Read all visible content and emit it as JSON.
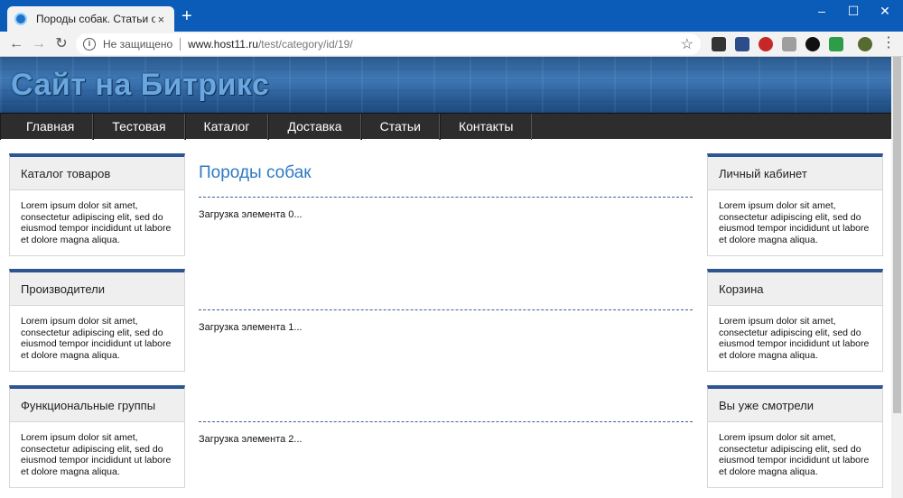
{
  "browser": {
    "tab_title": "Породы собак. Статьи о домаш",
    "tab_close": "×",
    "new_tab": "+",
    "insecure_label": "Не защищено",
    "url_host": "www.host11.ru",
    "url_path": "/test/category/id/19/",
    "window_controls": [
      "–",
      "☐",
      "✕"
    ]
  },
  "site": {
    "title": "Сайт на Битрикс",
    "nav": [
      "Главная",
      "Тестовая",
      "Каталог",
      "Доставка",
      "Статьи",
      "Контакты"
    ]
  },
  "left_boxes": [
    {
      "title": "Каталог товаров",
      "text": "Lorem ipsum dolor sit amet, consectetur adipiscing elit, sed do eiusmod tempor incididunt ut labore et dolore magna aliqua."
    },
    {
      "title": "Производители",
      "text": "Lorem ipsum dolor sit amet, consectetur adipiscing elit, sed do eiusmod tempor incididunt ut labore et dolore magna aliqua."
    },
    {
      "title": "Функциональные группы",
      "text": "Lorem ipsum dolor sit amet, consectetur adipiscing elit, sed do eiusmod tempor incididunt ut labore et dolore magna aliqua."
    }
  ],
  "right_boxes": [
    {
      "title": "Личный кабинет",
      "text": "Lorem ipsum dolor sit amet, consectetur adipiscing elit, sed do eiusmod tempor incididunt ut labore et dolore magna aliqua."
    },
    {
      "title": "Корзина",
      "text": "Lorem ipsum dolor sit amet, consectetur adipiscing elit, sed do eiusmod tempor incididunt ut labore et dolore magna aliqua."
    },
    {
      "title": "Вы уже смотрели",
      "text": "Lorem ipsum dolor sit amet, consectetur adipiscing elit, sed do eiusmod tempor incididunt ut labore et dolore magna aliqua."
    }
  ],
  "content": {
    "heading": "Породы собак",
    "items": [
      "Загрузка элемента 0...",
      "Загрузка элемента 1...",
      "Загрузка элемента 2..."
    ]
  },
  "colors": {
    "chrome_blue": "#0b5cb8",
    "box_accent": "#2d5592",
    "heading_blue": "#2f7ac3",
    "nav_bg": "#2d2d2d"
  }
}
